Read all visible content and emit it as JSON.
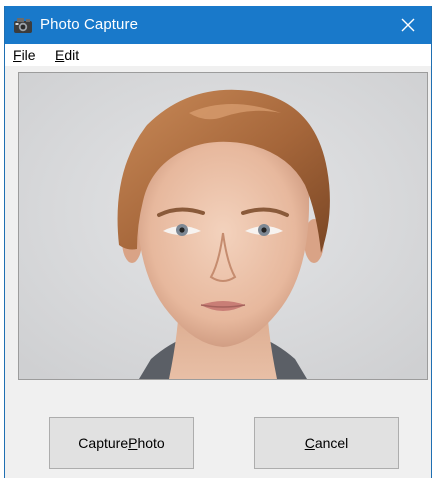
{
  "window": {
    "title": "Photo Capture",
    "icon": "camera-icon",
    "close_glyph": "✕",
    "accent_color": "#1979ca"
  },
  "menu": {
    "file": {
      "label_mnemonic": "F",
      "label_rest": "ile"
    },
    "edit": {
      "label_mnemonic": "E",
      "label_rest": "dit"
    }
  },
  "photo": {
    "description_icon": "portrait-photo",
    "background_color": "#d7d8da"
  },
  "buttons": {
    "capture": {
      "label_pre": "Capture ",
      "label_mnemonic": "P",
      "label_post": "hoto"
    },
    "cancel": {
      "label_pre": "",
      "label_mnemonic": "C",
      "label_post": "ancel"
    }
  }
}
